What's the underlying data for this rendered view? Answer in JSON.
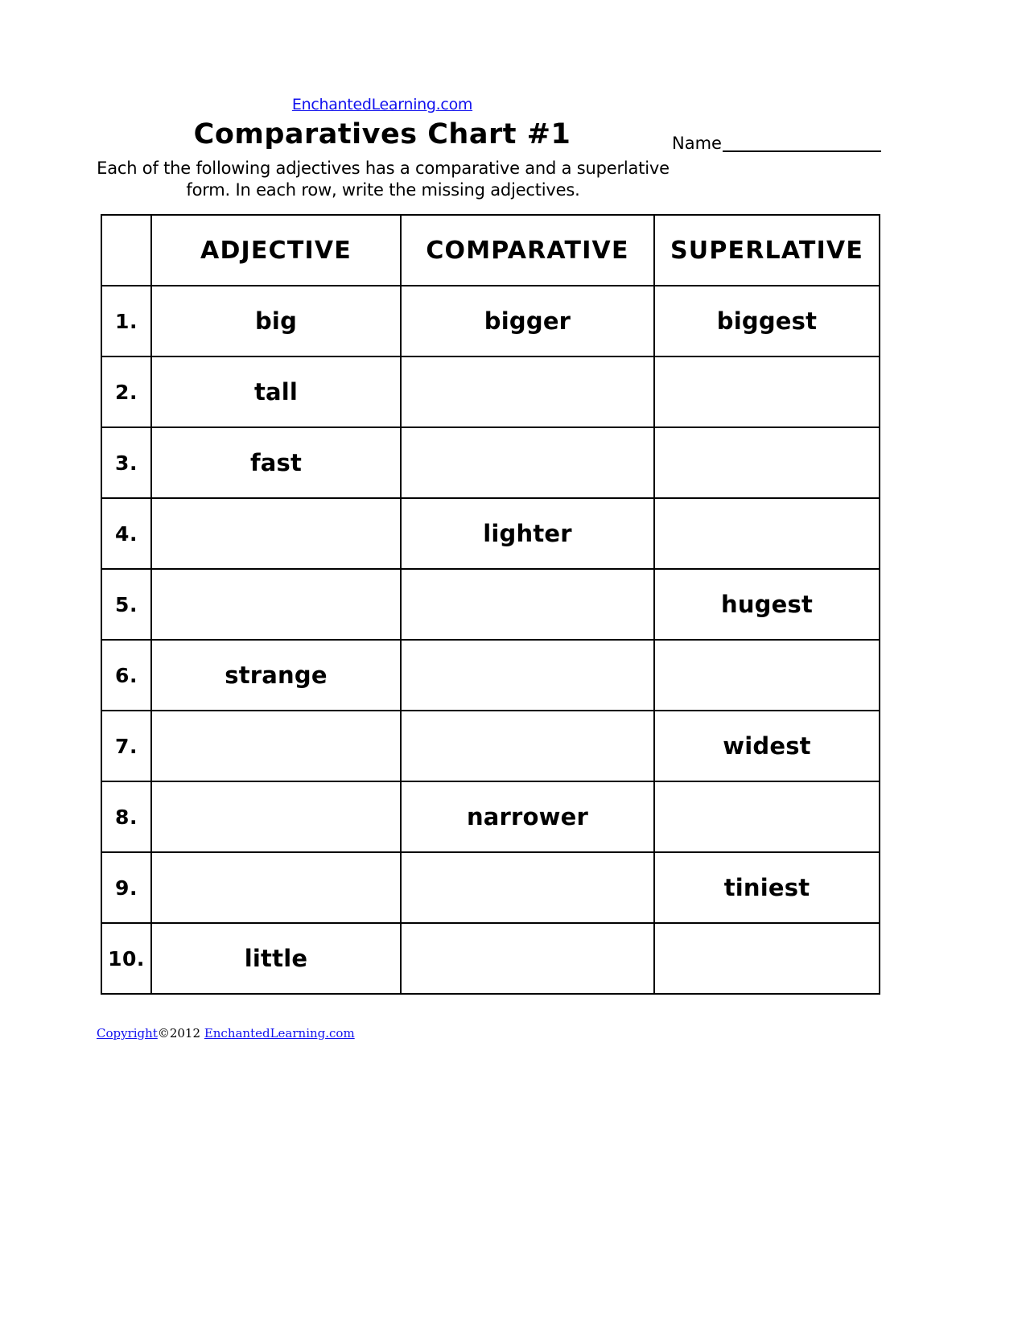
{
  "header": {
    "site_link": "EnchantedLearning.com",
    "title": "Comparatives Chart #1",
    "name_label": "Name",
    "instructions": "Each of the following adjectives has a comparative and a superlative form. In each row, write the missing adjectives."
  },
  "table": {
    "columns": [
      "",
      "ADJECTIVE",
      "COMPARATIVE",
      "SUPERLATIVE"
    ],
    "rows": [
      {
        "num": "1.",
        "adjective": "big",
        "comparative": "bigger",
        "superlative": "biggest"
      },
      {
        "num": "2.",
        "adjective": "tall",
        "comparative": "",
        "superlative": ""
      },
      {
        "num": "3.",
        "adjective": "fast",
        "comparative": "",
        "superlative": ""
      },
      {
        "num": "4.",
        "adjective": "",
        "comparative": "lighter",
        "superlative": ""
      },
      {
        "num": "5.",
        "adjective": "",
        "comparative": "",
        "superlative": "hugest"
      },
      {
        "num": "6.",
        "adjective": "strange",
        "comparative": "",
        "superlative": ""
      },
      {
        "num": "7.",
        "adjective": "",
        "comparative": "",
        "superlative": "widest"
      },
      {
        "num": "8.",
        "adjective": "",
        "comparative": "narrower",
        "superlative": ""
      },
      {
        "num": "9.",
        "adjective": "",
        "comparative": "",
        "superlative": "tiniest"
      },
      {
        "num": "10.",
        "adjective": "little",
        "comparative": "",
        "superlative": ""
      }
    ]
  },
  "footer": {
    "copyright_link": "Copyright",
    "symbol_year": "©2012",
    "site_link": "EnchantedLearning.com"
  },
  "colors": {
    "link": "#1111ee",
    "text": "#000000",
    "background": "#ffffff",
    "border": "#000000"
  }
}
